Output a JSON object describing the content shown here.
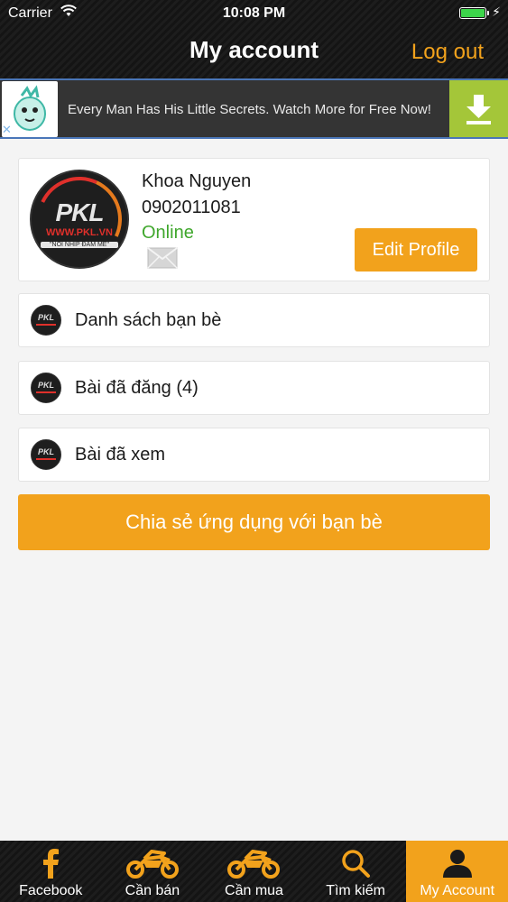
{
  "status_bar": {
    "carrier": "Carrier",
    "time": "10:08 PM"
  },
  "nav": {
    "title": "My account",
    "logout": "Log out"
  },
  "ad": {
    "text": "Every Man Has His Little Secrets. Watch More for Free Now!",
    "close": "✕"
  },
  "profile": {
    "name": "Khoa Nguyen",
    "phone": "0902011081",
    "status": "Online",
    "edit_label": "Edit Profile",
    "avatar": {
      "brand": "PKL",
      "brand_suffix": "vn",
      "url": "WWW.PKL.VN",
      "slogan": "\"NOI NHIP ĐAM ME\""
    }
  },
  "menu": [
    {
      "label": "Danh sách bạn bè"
    },
    {
      "label": "Bài đã đăng (4)"
    },
    {
      "label": "Bài đã xem"
    }
  ],
  "share_label": "Chia sẻ ứng dụng với bạn bè",
  "tabs": [
    {
      "label": "Facebook",
      "icon": "facebook-icon"
    },
    {
      "label": "Cần bán",
      "icon": "motorcycle-icon"
    },
    {
      "label": "Cần mua",
      "icon": "motorcycle-icon"
    },
    {
      "label": "Tìm kiếm",
      "icon": "search-icon"
    },
    {
      "label": "My Account",
      "icon": "user-icon"
    }
  ],
  "colors": {
    "accent": "#f2a21c",
    "online": "#3fa72c",
    "ad_button": "#a4c639",
    "bar_bg": "#1a1a1a"
  }
}
